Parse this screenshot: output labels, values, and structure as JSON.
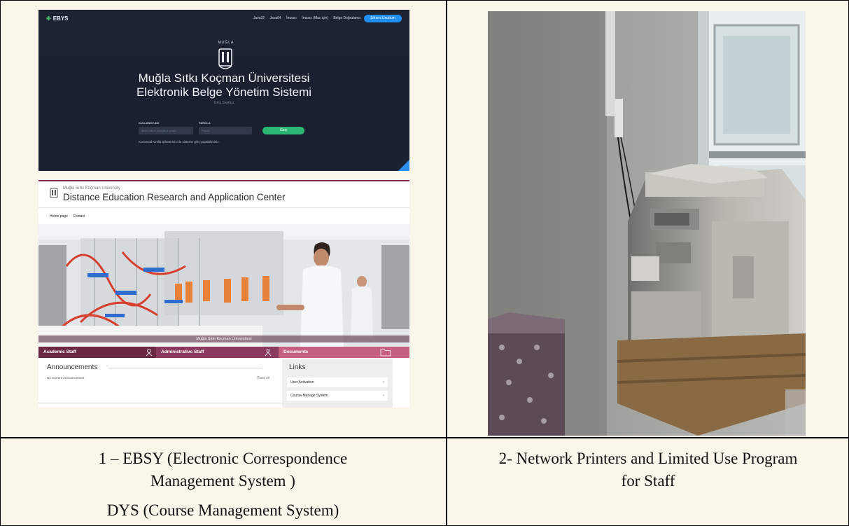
{
  "captions": {
    "left_line1": "1 – EBSY (Electronic Correspondence",
    "left_line2": "Management System )",
    "left_line3": "DYS (Course Management System)",
    "right_line1": "2- Network Printers and Limited Use Program",
    "right_line2": "for Staff"
  },
  "ebys": {
    "brand": "EBYS",
    "nav": [
      "Java32",
      "Java64",
      "İmzacı",
      "İmzacı (Mac için)",
      "Belge Doğrulama"
    ],
    "forgot_button": "Şifremi Unuttum",
    "crest_label": "MUĞLA",
    "title_line1": "Muğla Sıtkı Koçman Üniversitesi",
    "title_line2": "Elektronik Belge Yönetim Sistemi",
    "subtitle": "Giriş Sayfası",
    "username_label": "KULLANICI ADI",
    "username_placeholder": "@mu.edu.tr uzantılı e-posta",
    "password_label": "PAROLA",
    "password_placeholder": "Parola",
    "login_button": "Giriş",
    "note": "Kurumsal Kimlik Şifrelerinizi ile sisteme giriş yapabilirsiniz."
  },
  "dist": {
    "university": "Muğla Sıtkı Koçman University",
    "center_title": "Distance Education Research and Application Center",
    "menu": [
      "Home page",
      "Contact"
    ],
    "hero_caption": "Muğla Sıtkı Koçman Üniversitesi",
    "tabs": [
      "Academic Staff",
      "Administrative Staff",
      "Documents"
    ],
    "announcements_title": "Announcements",
    "announcements_empty": "No Current Announcement",
    "see_all": "☰See All",
    "links_title": "Links",
    "links": [
      "User Activation",
      "Course Manage System"
    ],
    "colors": {
      "tab_academic": "#6b2843",
      "tab_admin": "#8a3a5e",
      "tab_documents": "#c4627f"
    }
  }
}
